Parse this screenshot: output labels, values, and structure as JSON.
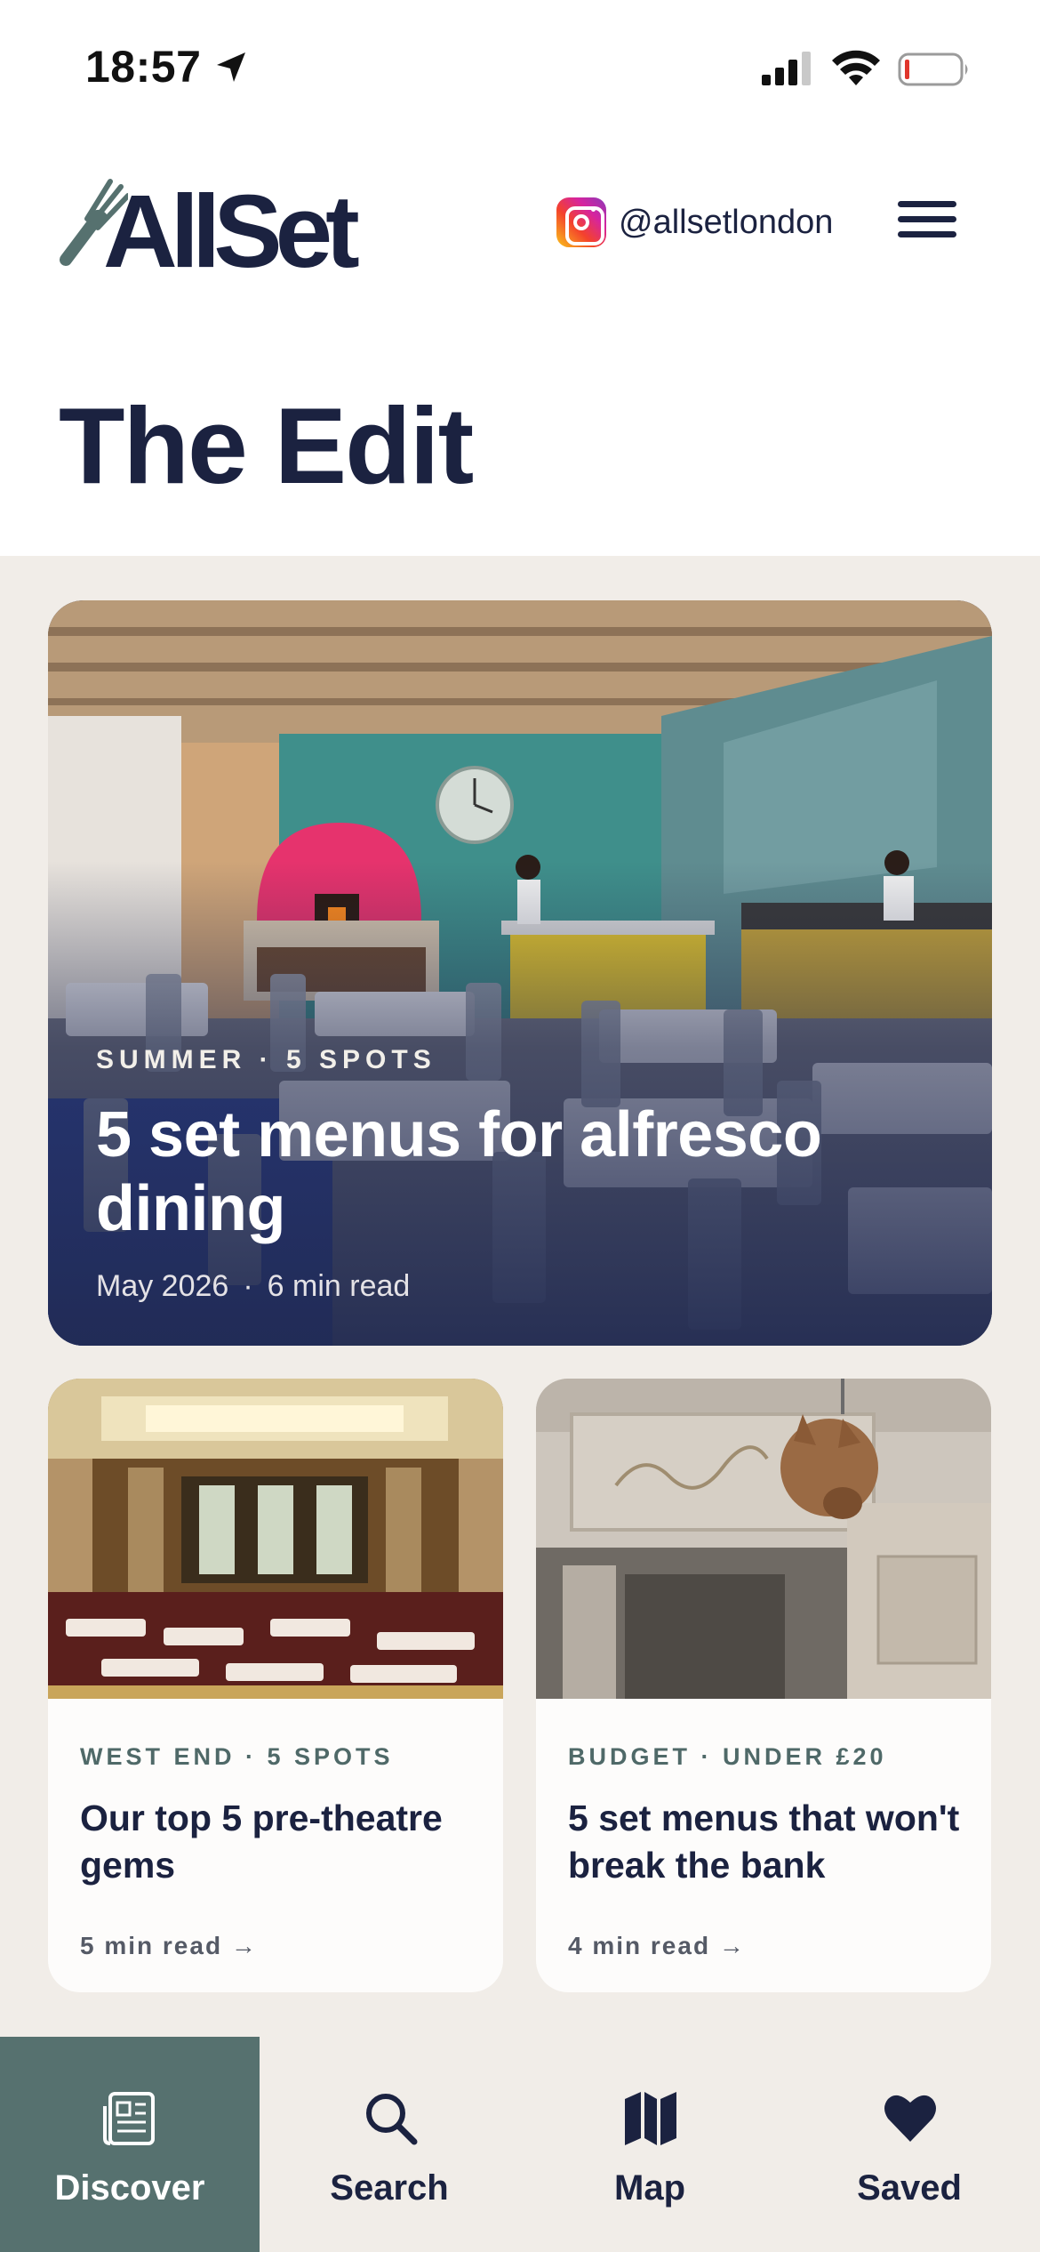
{
  "status_bar": {
    "time": "18:57"
  },
  "header": {
    "logo_text": "AllSet",
    "instagram_handle": "@allsetlondon"
  },
  "page": {
    "title": "The Edit"
  },
  "hero": {
    "eyebrow": "SUMMER · 5 SPOTS",
    "title": "5 set menus for alfresco dining",
    "date": "May 2026",
    "separator": "·",
    "read_time": "6 min read"
  },
  "cards": [
    {
      "eyebrow": "WEST END · 5 SPOTS",
      "title": "Our top 5 pre-theatre gems",
      "read_time": "5 min read →"
    },
    {
      "eyebrow": "BUDGET · UNDER £20",
      "title": "5 set menus that won't break the bank",
      "read_time": "4 min read →"
    }
  ],
  "tabs": [
    {
      "label": "Discover",
      "icon": "newspaper-icon",
      "active": true
    },
    {
      "label": "Search",
      "icon": "search-icon",
      "active": false
    },
    {
      "label": "Map",
      "icon": "map-icon",
      "active": false
    },
    {
      "label": "Saved",
      "icon": "heart-icon",
      "active": false
    }
  ],
  "colors": {
    "navy": "#1b2240",
    "feed_background": "#f1ede8",
    "active_tab": "#56716f",
    "eyebrow_green": "#4f6968"
  }
}
